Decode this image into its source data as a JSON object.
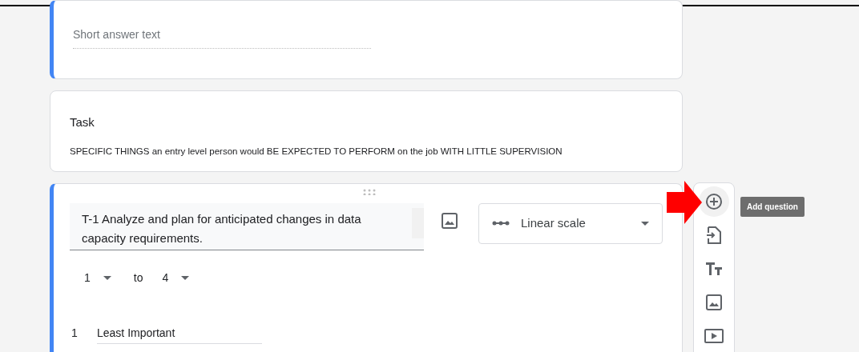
{
  "name_question": {
    "placeholder": "Short answer text",
    "selected": true
  },
  "section": {
    "title": "Task",
    "description": "SPECIFIC THINGS an entry level person would BE EXPECTED TO PERFORM on the job WITH LITTLE SUPERVISION"
  },
  "scale_question": {
    "selected": true,
    "title": "T-1 Analyze and plan for anticipated changes in data capacity requirements.",
    "type": "Linear scale",
    "from": "1",
    "to_word": "to",
    "to": "4",
    "labels": [
      {
        "number": "1",
        "text": "Least Important"
      }
    ]
  },
  "toolbar": {
    "tooltip": "Add question",
    "items": [
      {
        "kind": "add",
        "hovered": true
      },
      {
        "kind": "import",
        "hovered": false
      },
      {
        "kind": "title",
        "hovered": false
      },
      {
        "kind": "image",
        "hovered": false
      },
      {
        "kind": "video",
        "hovered": false
      }
    ]
  }
}
